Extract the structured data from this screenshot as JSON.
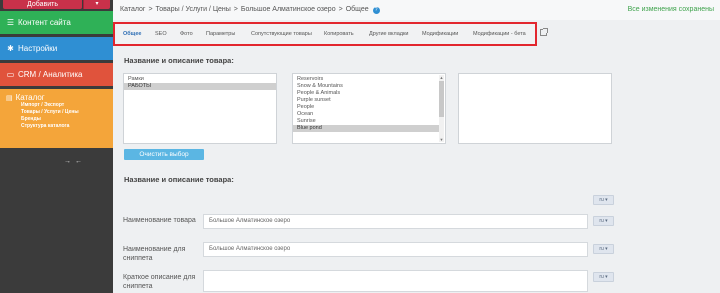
{
  "sidebar": {
    "add_label": "Добавить",
    "add_caret": "▾",
    "content_label": "Контент сайта",
    "settings_label": "Настройки",
    "crm_label": "CRM / Аналитика",
    "catalog_label": "Каталог",
    "catalog_items": [
      "Импорт / Экспорт",
      "Товары / Услуги / Цены",
      "Бренды",
      "Структура каталога"
    ],
    "collapse_arrows": "→ ←",
    "colors": {
      "content": "#2fb157",
      "settings": "#2f8fd3",
      "crm": "#e0533c",
      "catalog": "#f4a53a",
      "add": "#c8314a"
    }
  },
  "breadcrumb": {
    "items": [
      "Каталог",
      "Товары / Услуги / Цены",
      "Большое Алматинское озеро",
      "Общее"
    ],
    "separator": ">",
    "help": "?"
  },
  "status_text": "Все изменения сохранены",
  "tabs": [
    "Общее",
    "SEO",
    "Фото",
    "Параметры",
    "Сопутствующие товары",
    "Копировать",
    "Другие вкладки",
    "Модификации",
    "Модификации - бета"
  ],
  "section1": {
    "title": "Название и описание товара:",
    "list1": [
      "Рамки",
      "РАБОТЫ"
    ],
    "list1_selected": "РАБОТЫ",
    "list2": [
      "Reservoirs",
      "Snow & Mountains",
      "People & Animals",
      "Purple sunset",
      "People",
      "Ocean",
      "Sunrise",
      "Blue pond"
    ],
    "list2_selected": "Blue pond",
    "clear_label": "Очистить выбор"
  },
  "section2": {
    "title": "Название и описание товара:",
    "lang_label": "ru ▾",
    "fields": [
      {
        "label": "Наименование товара",
        "value": "Большое Алматинское озеро"
      },
      {
        "label": "Наименование для сниппета",
        "value": "Большое Алматинское озеро"
      },
      {
        "label": "Краткое описание для сниппета",
        "value": ""
      }
    ]
  }
}
